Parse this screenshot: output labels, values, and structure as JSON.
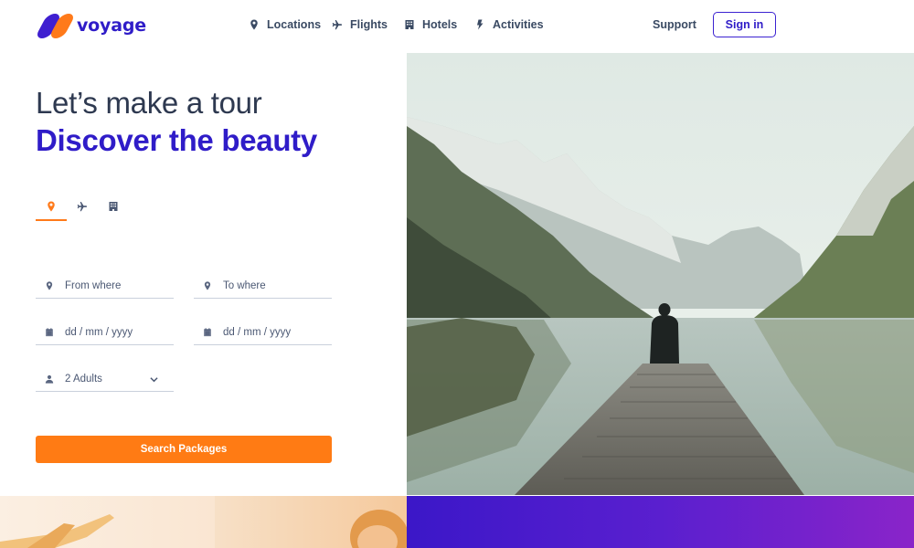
{
  "brand": {
    "name": "voyage",
    "color_primary": "#2f1cc8",
    "color_accent": "#ff7a1a"
  },
  "nav": {
    "links": [
      {
        "label": "Locations",
        "icon": "location-pin-icon"
      },
      {
        "label": "Flights",
        "icon": "airplane-icon"
      },
      {
        "label": "Hotels",
        "icon": "hotel-icon"
      },
      {
        "label": "Activities",
        "icon": "bolt-icon"
      }
    ],
    "support_label": "Support",
    "signin_label": "Sign in"
  },
  "hero": {
    "title_line1": "Let’s make a tour",
    "title_line2": "Discover the beauty",
    "tabs": [
      {
        "icon": "location-pin-icon",
        "active": true
      },
      {
        "icon": "airplane-icon",
        "active": false
      },
      {
        "icon": "hotel-icon",
        "active": false
      }
    ]
  },
  "form": {
    "from_placeholder": "From where",
    "to_placeholder": "To where",
    "date_from_placeholder": "dd / mm / yyyy",
    "date_to_placeholder": "dd / mm / yyyy",
    "guests_value": "2 Adults",
    "search_label": "Search Packages"
  }
}
